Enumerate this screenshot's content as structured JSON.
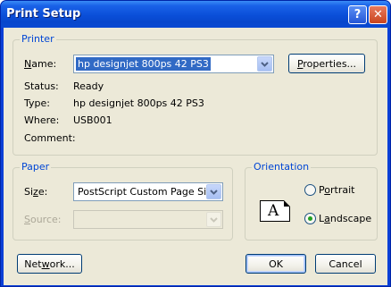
{
  "window": {
    "title": "Print Setup"
  },
  "titlebar": {
    "help_glyph": "?",
    "close_glyph": "✕"
  },
  "printer": {
    "group_title": "Printer",
    "name_label_u": "N",
    "name_label_rest": "ame:",
    "name_value": "hp designjet 800ps 42 PS3",
    "properties_u": "P",
    "properties_rest": "roperties...",
    "status_label": "Status:",
    "status_value": "Ready",
    "type_label": "Type:",
    "type_value": "hp designjet 800ps 42 PS3",
    "where_label": "Where:",
    "where_value": "USB001",
    "comment_label": "Comment:",
    "comment_value": ""
  },
  "paper": {
    "group_title": "Paper",
    "size_label_pre": "Si",
    "size_label_u": "z",
    "size_label_rest": "e:",
    "size_value": "PostScript Custom Page Size",
    "source_label_u": "S",
    "source_label_rest": "ource:",
    "source_value": ""
  },
  "orientation": {
    "group_title": "Orientation",
    "icon_letter": "A",
    "portrait_u": "o",
    "portrait_pre": "P",
    "portrait_rest": "rtrait",
    "landscape_u": "a",
    "landscape_pre": "L",
    "landscape_rest": "ndscape",
    "selected": "landscape"
  },
  "buttons": {
    "network_pre": "Net",
    "network_u": "w",
    "network_rest": "ork...",
    "ok": "OK",
    "cancel": "Cancel"
  }
}
